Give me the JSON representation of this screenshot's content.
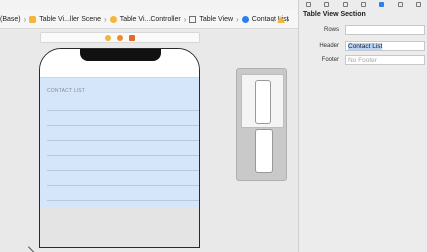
{
  "breadcrumb": {
    "items": [
      {
        "label": "(Base)",
        "icon": "none"
      },
      {
        "label": "Table Vi...ller Scene",
        "icon": "scene-icon"
      },
      {
        "label": "Table Vi...Controller",
        "icon": "controller-icon"
      },
      {
        "label": "Table View",
        "icon": "tableview-icon"
      },
      {
        "label": "Contact List",
        "icon": "section-icon"
      }
    ]
  },
  "canvas": {
    "section_header": "CONTACT LIST",
    "row_count": 7
  },
  "inspector": {
    "title": "Table View Section",
    "rows_label": "Rows",
    "rows_value": "",
    "header_label": "Header",
    "header_value": "Contact List",
    "footer_label": "Footer",
    "footer_placeholder": "No Footer"
  },
  "colors": {
    "accent": "#2d7ff0",
    "scene_icon": "#f3b53b",
    "table_bg": "#d5e6fb"
  }
}
